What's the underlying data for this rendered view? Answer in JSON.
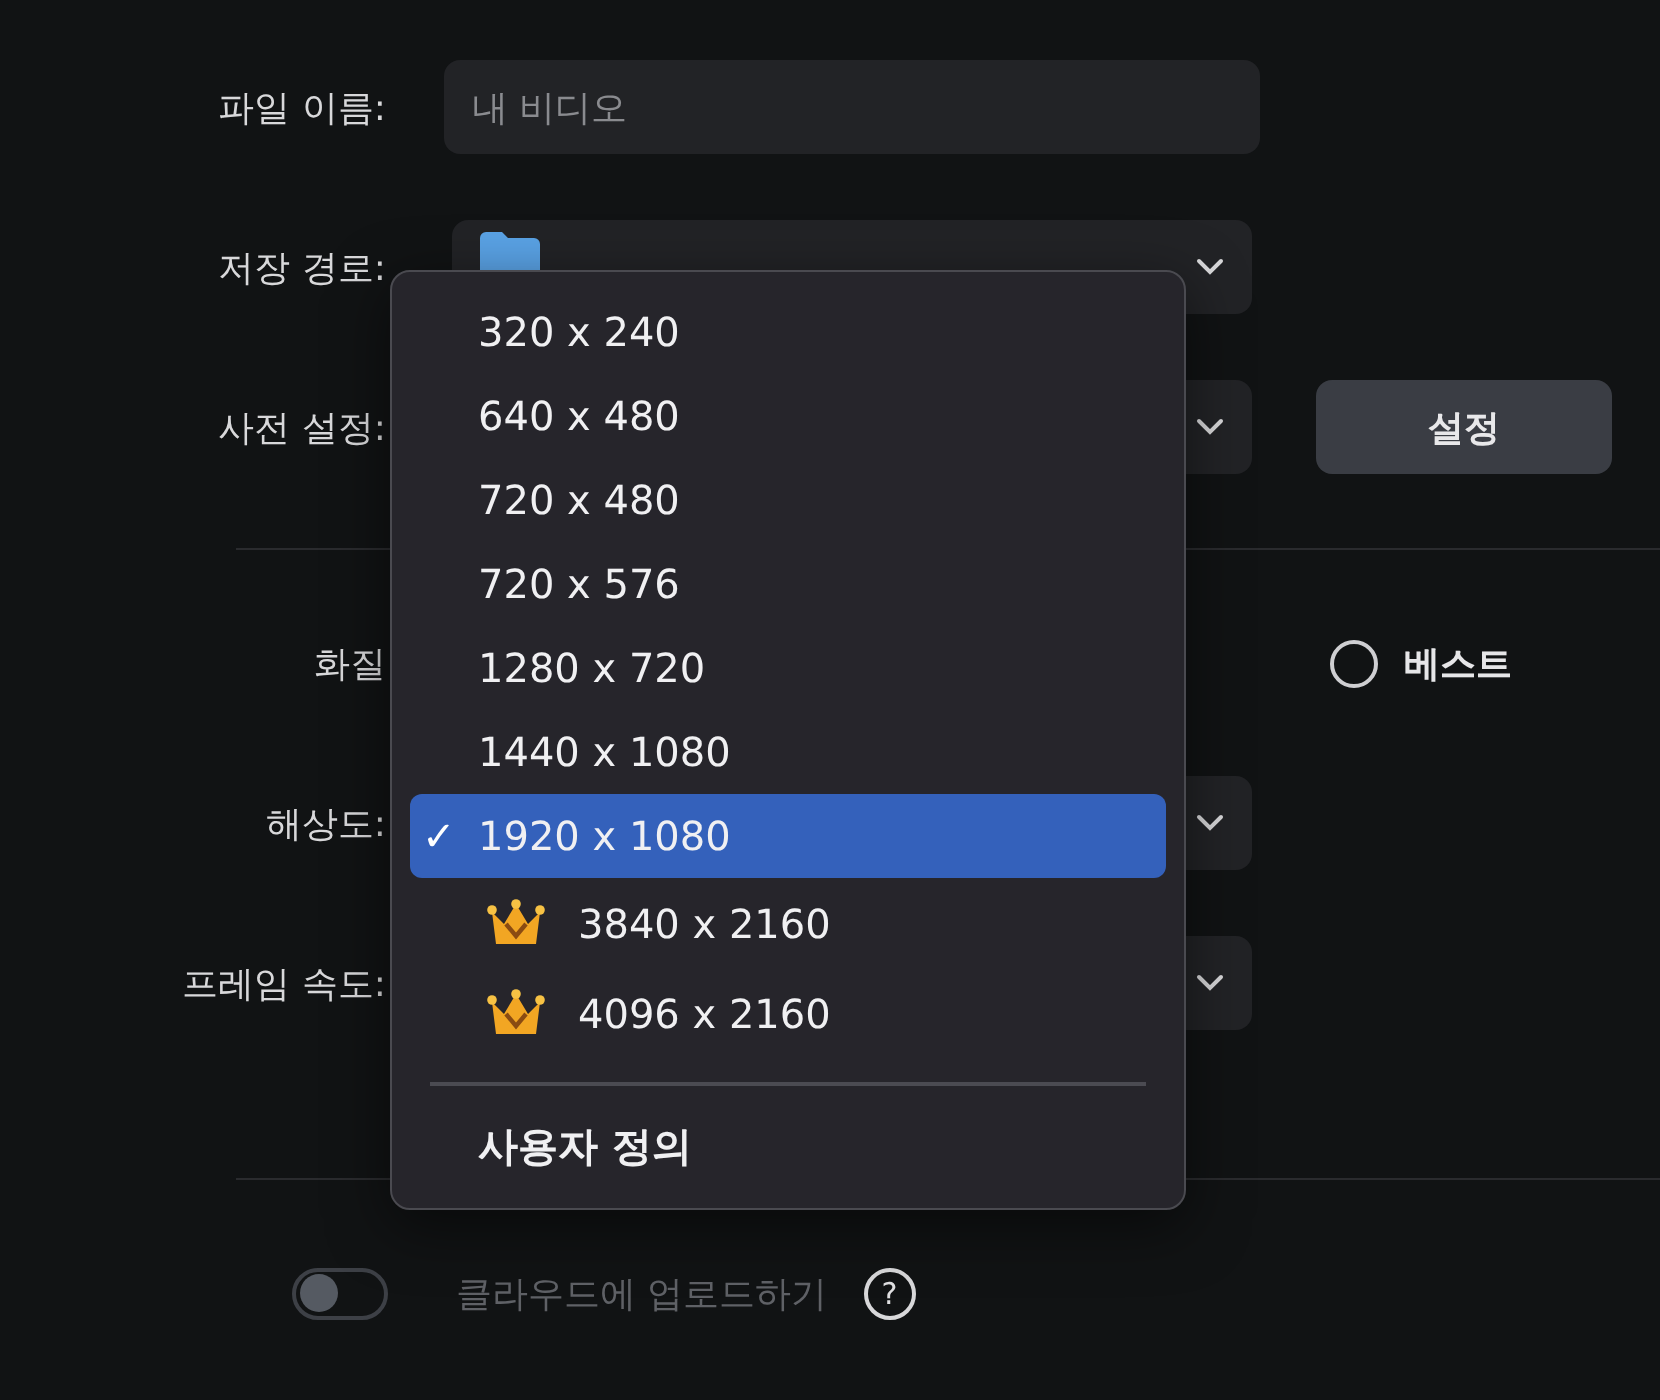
{
  "form": {
    "file_name": {
      "label": "파일 이름:",
      "placeholder": "내 비디오"
    },
    "save_path": {
      "label": "저장 경로:"
    },
    "preset": {
      "label": "사전 설정:",
      "button": "설정"
    },
    "quality": {
      "label": "화질",
      "option": {
        "label": "베스트",
        "selected": false
      }
    },
    "resolution": {
      "label": "해상도:"
    },
    "frame_rate": {
      "label": "프레임 속도:"
    },
    "cloud_upload": {
      "label": "클라우드에 업로드하기",
      "on": false,
      "help": "?"
    }
  },
  "menu": {
    "check_mark": "✓",
    "items": [
      {
        "kind": "option",
        "label": "320 x 240",
        "selected": false,
        "premium": false
      },
      {
        "kind": "option",
        "label": "640 x 480",
        "selected": false,
        "premium": false
      },
      {
        "kind": "option",
        "label": "720 x 480",
        "selected": false,
        "premium": false
      },
      {
        "kind": "option",
        "label": "720 x 576",
        "selected": false,
        "premium": false
      },
      {
        "kind": "option",
        "label": "1280 x 720",
        "selected": false,
        "premium": false
      },
      {
        "kind": "option",
        "label": "1440 x 1080",
        "selected": false,
        "premium": false
      },
      {
        "kind": "option",
        "label": "1920 x 1080",
        "selected": true,
        "premium": false
      },
      {
        "kind": "option",
        "label": "3840 x 2160",
        "selected": false,
        "premium": true
      },
      {
        "kind": "option",
        "label": "4096 x 2160",
        "selected": false,
        "premium": true
      },
      {
        "kind": "separator"
      },
      {
        "kind": "option",
        "label": "사용자 정의",
        "selected": false,
        "premium": false
      }
    ]
  }
}
